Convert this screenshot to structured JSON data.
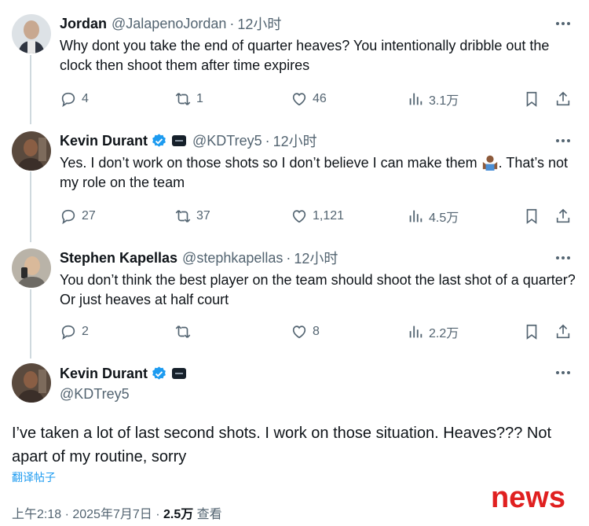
{
  "tweets": [
    {
      "name": "Jordan",
      "handle": "@JalapenoJordan",
      "time": "12小时",
      "text": "Why dont you take the end of quarter heaves? You intentionally dribble out the clock then shoot them after time expires",
      "replies": "4",
      "retweets": "1",
      "likes": "46",
      "views": "3.1万"
    },
    {
      "name": "Kevin Durant",
      "handle": "@KDTrey5",
      "time": "12小时",
      "text_part1": "Yes. I don’t work on those shots so I don’t believe I can make them",
      "text_part2": ". That’s not my role on the team",
      "replies": "27",
      "retweets": "37",
      "likes": "1,121",
      "views": "4.5万"
    },
    {
      "name": "Stephen Kapellas",
      "handle": "@stephkapellas",
      "time": "12小时",
      "text": "You don’t think the best player on the team should shoot the last shot of a quarter? Or just heaves at half court",
      "replies": "2",
      "retweets": "",
      "likes": "8",
      "views": "2.2万"
    }
  ],
  "main_tweet": {
    "name": "Kevin Durant",
    "handle": "@KDTrey5",
    "text": "I’ve taken a lot of last second shots. I work on those situation. Heaves??? Not apart of my routine, sorry",
    "translate_label": "翻译帖子",
    "time_date": "上午2:18 · 2025年7月7日 · ",
    "views": "2.5万",
    "views_label": " 查看"
  },
  "watermark": "news",
  "icons": [
    "reply-icon",
    "retweet-icon",
    "like-icon",
    "views-icon",
    "bookmark-icon",
    "share-icon",
    "verified-icon",
    "more-icon"
  ],
  "colors": {
    "text": "#0f1419",
    "secondary": "#536471",
    "verified": "#1d9bf0",
    "link": "#1d9bf0",
    "watermark": "#e02020"
  }
}
